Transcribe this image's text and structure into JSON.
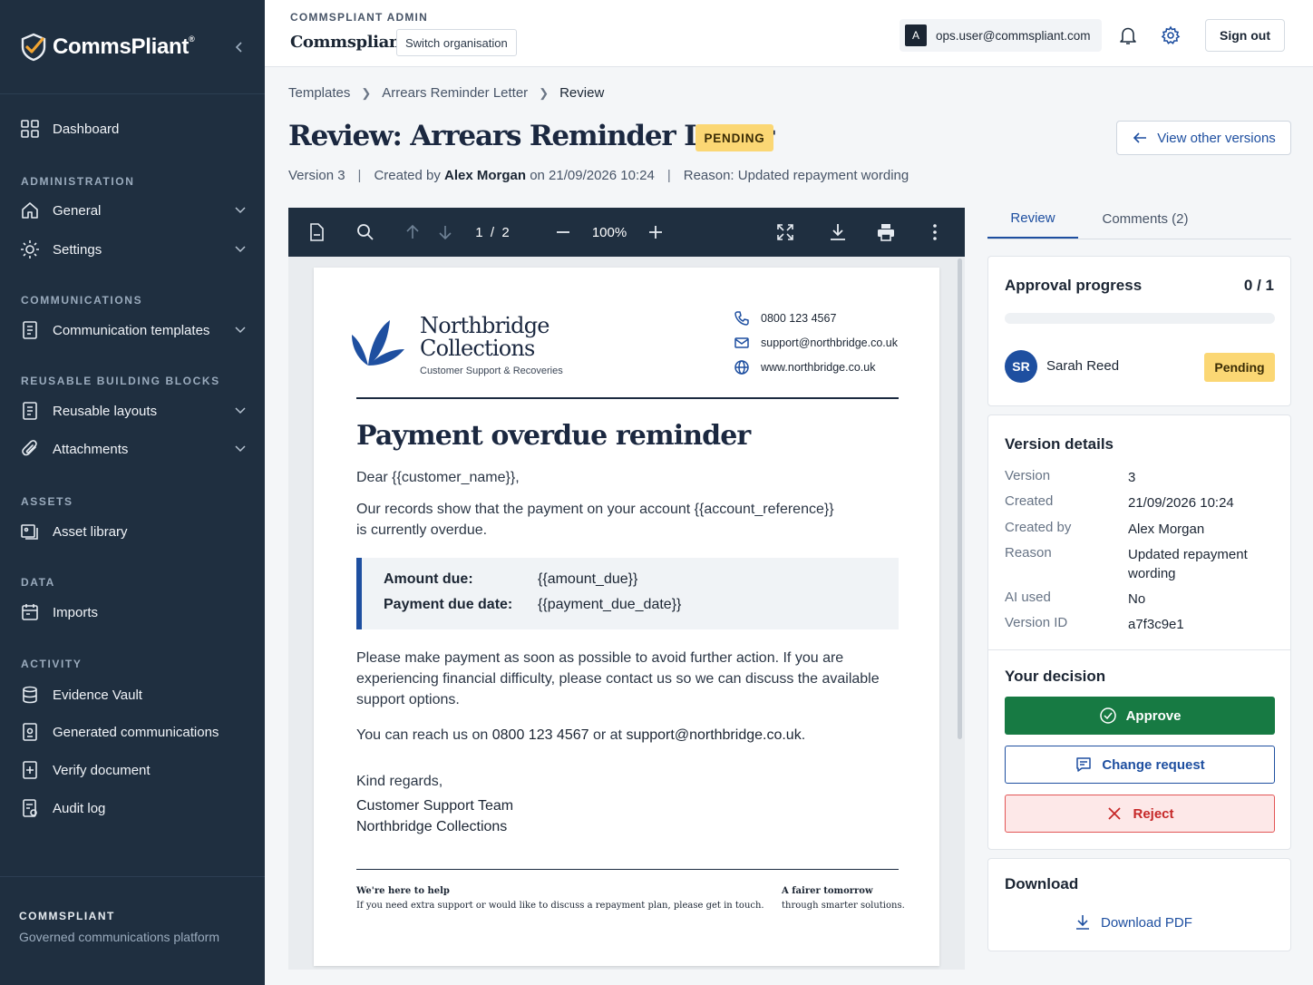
{
  "sidebar": {
    "brand": "CommsPliant",
    "brand_mark": "®",
    "dashboard": "Dashboard",
    "sections": {
      "administration": "ADMINISTRATION",
      "communications": "COMMUNICATIONS",
      "building_blocks": "REUSABLE BUILDING BLOCKS",
      "assets": "ASSETS",
      "data": "DATA",
      "activity": "ACTIVITY"
    },
    "items": {
      "general": "General",
      "settings": "Settings",
      "communication_templates": "Communication templates",
      "reusable_layouts": "Reusable layouts",
      "attachments": "Attachments",
      "asset_library": "Asset library",
      "imports": "Imports",
      "evidence_vault": "Evidence Vault",
      "generated_communications": "Generated communications",
      "verify_document": "Verify document",
      "audit_log": "Audit log"
    },
    "footer_title": "COMMSPLIANT",
    "footer_subtitle": "Governed communications platform"
  },
  "topbar": {
    "admin_label": "COMMSPLIANT ADMIN",
    "org_name": "Commspliant",
    "switch_org": "Switch organisation",
    "user_initial": "A",
    "user_email": "ops.user@commspliant.com",
    "sign_out": "Sign out"
  },
  "breadcrumb": [
    "Templates",
    "Arrears Reminder Letter",
    "Review"
  ],
  "page": {
    "title": "Review: Arrears Reminder Letter",
    "status": "PENDING",
    "view_versions": "View other versions",
    "meta_version": "Version 3",
    "meta_created_prefix": "Created by",
    "meta_author": "Alex Morgan",
    "meta_on": "on 21/09/2026 10:24",
    "meta_reason": "Reason: Updated repayment wording"
  },
  "viewer": {
    "page_current": "1",
    "page_sep": "/",
    "page_total": "2",
    "zoom": "100%"
  },
  "letter": {
    "company_line1": "Northbridge",
    "company_line2": "Collections",
    "company_tagline": "Customer Support & Recoveries",
    "phone": "0800 123 4567",
    "email": "support@northbridge.co.uk",
    "website": "www.northbridge.co.uk",
    "heading": "Payment overdue reminder",
    "greeting": "Dear {{customer_name}},",
    "para1_line1": "Our records show that the payment on your account {{account_reference}}",
    "para1_line2": "is currently overdue.",
    "amount_label": "Amount due:",
    "amount_value": "{{amount_due}}",
    "due_label": "Payment due date:",
    "due_value": "{{payment_due_date}}",
    "para2_line1": "Please make payment as soon as possible to avoid further action. If you are",
    "para2_line2": "experiencing financial difficulty, please contact us so we can discuss the available",
    "para2_line3": "support options.",
    "reach_prefix": "You can reach us on",
    "reach_phone": "0800 123 4567",
    "reach_mid": "or at",
    "reach_email": "support@northbridge.co.uk",
    "reach_end": ".",
    "signoff": "Kind regards,",
    "sign_team": "Customer Support Team",
    "sign_company": "Northbridge Collections",
    "footer_left_title": "We're here to help",
    "footer_left_text": "If you need extra support or would like to discuss a repayment plan, please get in touch.",
    "footer_right_title": "A fairer tomorrow",
    "footer_right_text": "through smarter solutions."
  },
  "panel": {
    "tab_review": "Review",
    "tab_comments": "Comments (2)",
    "approval_title": "Approval progress",
    "approval_count": "0 / 1",
    "approval_fraction": 0,
    "approver_initials": "SR",
    "approver_name": "Sarah Reed",
    "approver_status": "Pending",
    "details_title": "Version details",
    "details": {
      "version_label": "Version",
      "version_value": "3",
      "created_label": "Created",
      "created_value": "21/09/2026 10:24",
      "created_by_label": "Created by",
      "created_by_value": "Alex Morgan",
      "reason_label": "Reason",
      "reason_value": "Updated repayment wording",
      "ai_label": "AI used",
      "ai_value": "No",
      "id_label": "Version ID",
      "id_value": "a7f3c9e1"
    },
    "decision_title": "Your decision",
    "approve": "Approve",
    "change_request": "Change request",
    "reject": "Reject",
    "download_title": "Download",
    "download_pdf": "Download PDF"
  },
  "colors": {
    "sidebar": "#1f2f40",
    "accent": "#1e4fa0",
    "pending": "#fbd774",
    "approve": "#177a43",
    "reject": "#c62828"
  }
}
